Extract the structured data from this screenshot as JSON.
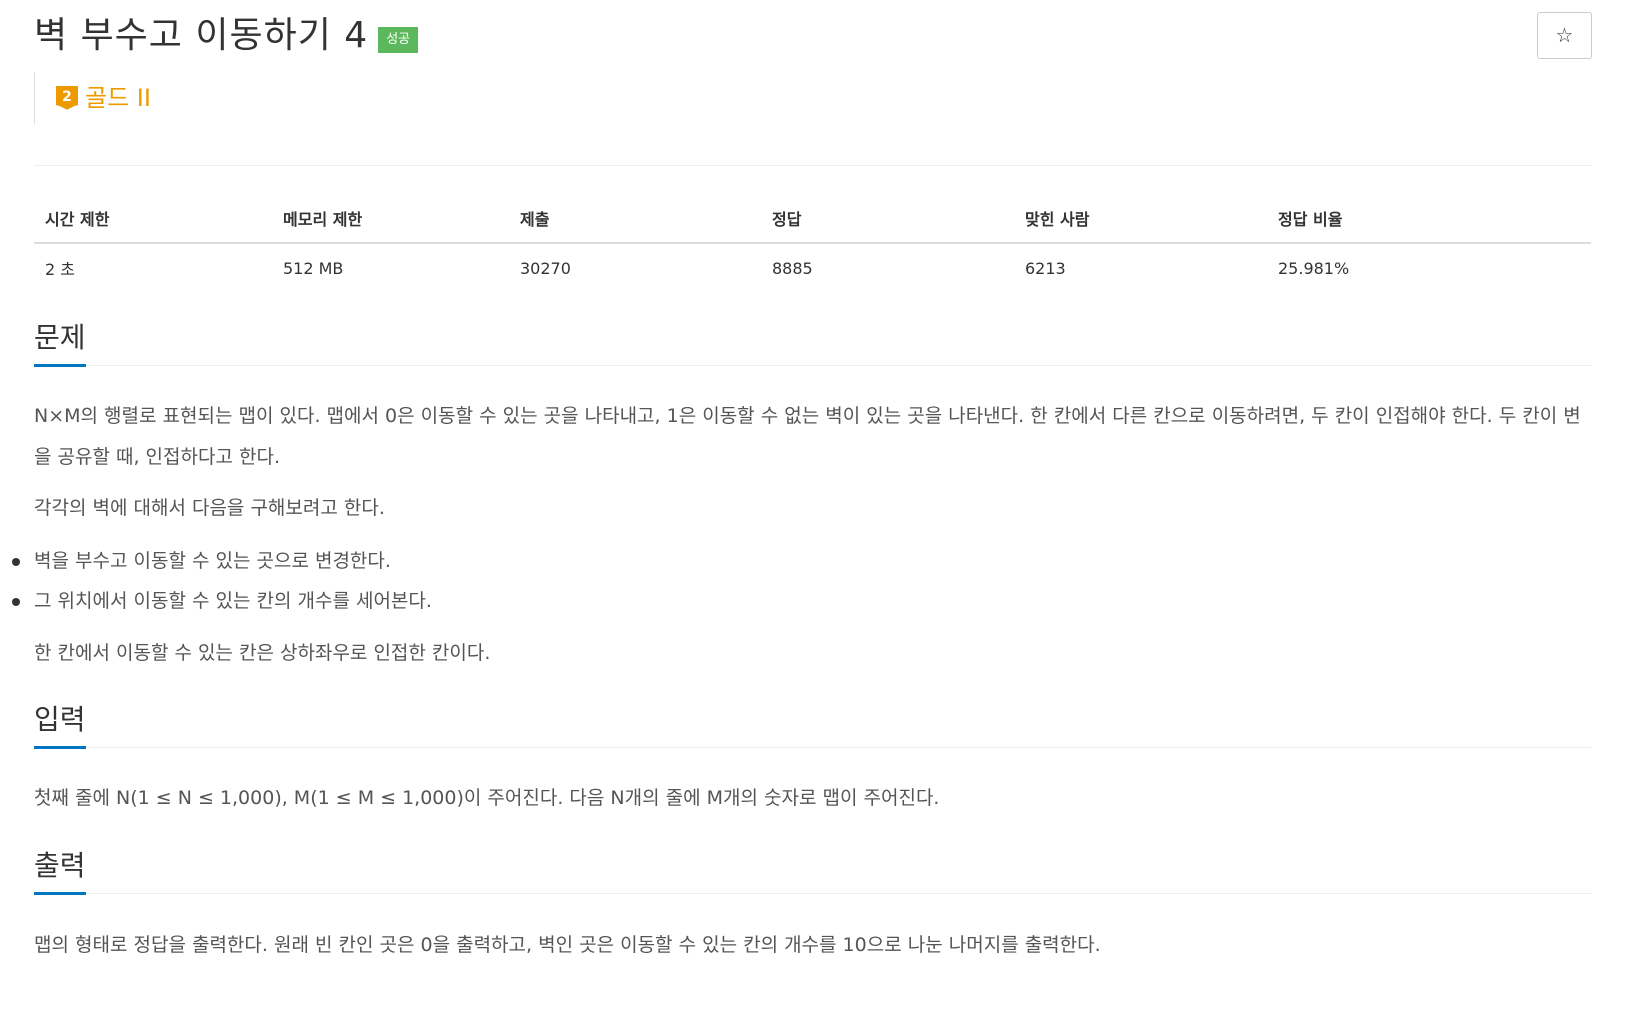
{
  "problem": {
    "title": "벽 부수고 이동하기 4",
    "result_badge": "성공",
    "tier_label": "골드 II",
    "tier_number": "2"
  },
  "info_table": {
    "headers": [
      "시간 제한",
      "메모리 제한",
      "제출",
      "정답",
      "맞힌 사람",
      "정답 비율"
    ],
    "values": [
      "2 초",
      "512 MB",
      "30270",
      "8885",
      "6213",
      "25.981%"
    ]
  },
  "sections": {
    "description": {
      "heading": "문제",
      "p1": "N×M의 행렬로 표현되는 맵이 있다. 맵에서 0은 이동할 수 있는 곳을 나타내고, 1은 이동할 수 없는 벽이 있는 곳을 나타낸다. 한 칸에서 다른 칸으로 이동하려면, 두 칸이 인접해야 한다. 두 칸이 변을 공유할 때, 인접하다고 한다.",
      "p2": "각각의 벽에 대해서 다음을 구해보려고 한다.",
      "bullets": [
        "벽을 부수고 이동할 수 있는 곳으로 변경한다.",
        "그 위치에서 이동할 수 있는 칸의 개수를 세어본다."
      ],
      "p3": "한 칸에서 이동할 수 있는 칸은 상하좌우로 인접한 칸이다."
    },
    "input": {
      "heading": "입력",
      "text": "첫째 줄에 N(1 ≤ N ≤ 1,000), M(1 ≤ M ≤ 1,000)이 주어진다. 다음 N개의 줄에 M개의 숫자로 맵이 주어진다."
    },
    "output": {
      "heading": "출력",
      "text": "맵의 형태로 정답을 출력한다. 원래 빈 칸인 곳은 0을 출력하고, 벽인 곳은 이동할 수 있는 칸의 개수를 10으로 나눈 나머지를 출력한다."
    }
  },
  "icons": {
    "star_button": "star-icon",
    "tier_badge": "gold-tier-icon"
  },
  "colors": {
    "success": "#5cb85c",
    "tier_gold": "#ec9a00",
    "accent": "#0076c0"
  }
}
